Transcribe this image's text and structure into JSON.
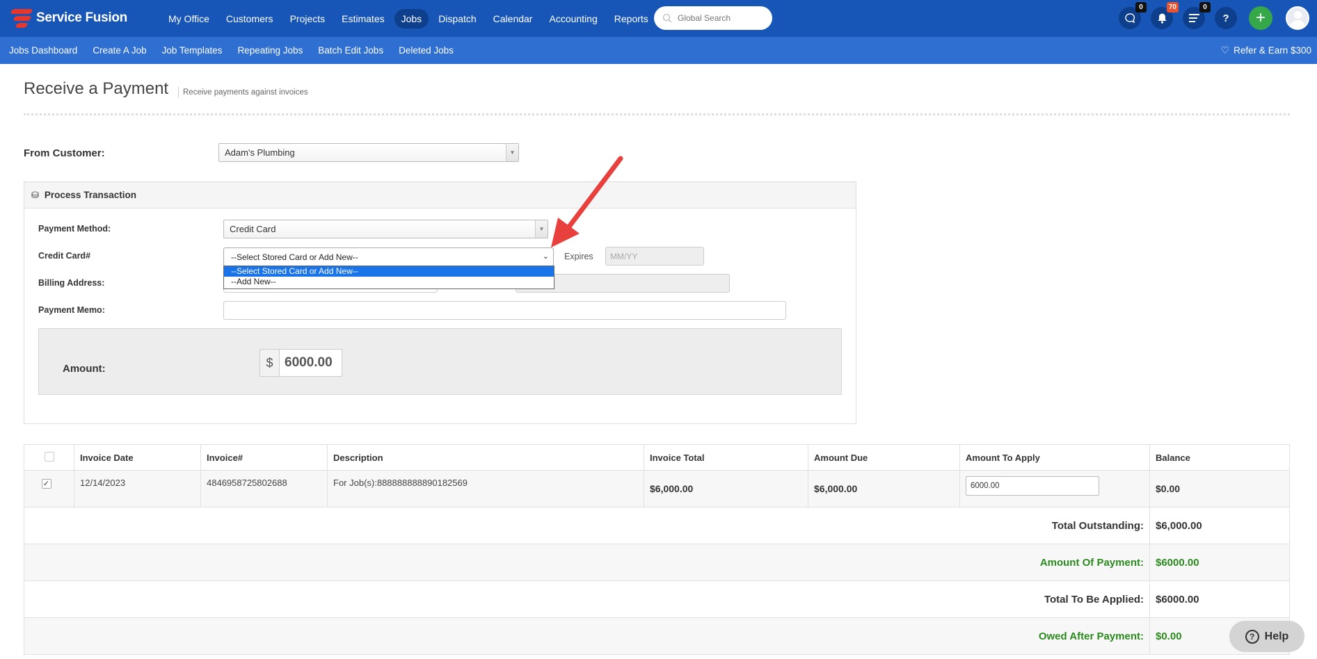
{
  "app": {
    "name": "Service Fusion"
  },
  "topnav": {
    "items": [
      "My Office",
      "Customers",
      "Projects",
      "Estimates",
      "Jobs",
      "Dispatch",
      "Calendar",
      "Accounting",
      "Reports"
    ],
    "active": "Jobs",
    "search_placeholder": "Global Search",
    "chat_badge": "0",
    "notifications_badge": "70",
    "tasks_badge": "0",
    "help_glyph": "?",
    "plus_glyph": "+"
  },
  "subnav": {
    "items": [
      "Jobs Dashboard",
      "Create A Job",
      "Job Templates",
      "Repeating Jobs",
      "Batch Edit Jobs",
      "Deleted Jobs"
    ],
    "refer": "Refer & Earn $300"
  },
  "page": {
    "title": "Receive a Payment",
    "subtitle": "Receive payments against invoices"
  },
  "customer": {
    "label": "From Customer:",
    "value": "Adam's Plumbing"
  },
  "transaction": {
    "title": "Process Transaction",
    "payment_method_label": "Payment Method:",
    "payment_method_value": "Credit Card",
    "credit_card_label": "Credit Card#",
    "credit_card_value": "--Select Stored Card or Add New--",
    "credit_card_options": [
      "--Select Stored Card or Add New--",
      "--Add New--"
    ],
    "expires_label": "Expires",
    "expires_placeholder": "MM/YY",
    "billing_label": "Billing Address:",
    "memo_label": "Payment Memo:",
    "amount_label": "Amount:",
    "currency": "$",
    "amount": "6000.00"
  },
  "invoices": {
    "columns": [
      "Invoice Date",
      "Invoice#",
      "Description",
      "Invoice Total",
      "Amount Due",
      "Amount To Apply",
      "Balance"
    ],
    "rows": [
      {
        "checked": "✓",
        "date": "12/14/2023",
        "number": "4846958725802688",
        "description": "For Job(s):888888888890182569",
        "total": "$6,000.00",
        "due": "$6,000.00",
        "apply": "6000.00",
        "balance": "$0.00"
      }
    ]
  },
  "summary": {
    "total_outstanding_label": "Total Outstanding:",
    "total_outstanding": "$6,000.00",
    "amount_of_payment_label": "Amount Of Payment:",
    "amount_of_payment": "$6000.00",
    "total_applied_label": "Total To Be Applied:",
    "total_applied": "$6000.00",
    "owed_after_label": "Owed After Payment:",
    "owed_after": "$0.00"
  },
  "help": {
    "label": "Help"
  },
  "colors": {
    "topbar": "#1755b6",
    "subbar": "#2e6fd1",
    "brand_red": "#e8362a",
    "annotation_arrow": "#e8413d",
    "positive_green": "#2b8a1e"
  }
}
